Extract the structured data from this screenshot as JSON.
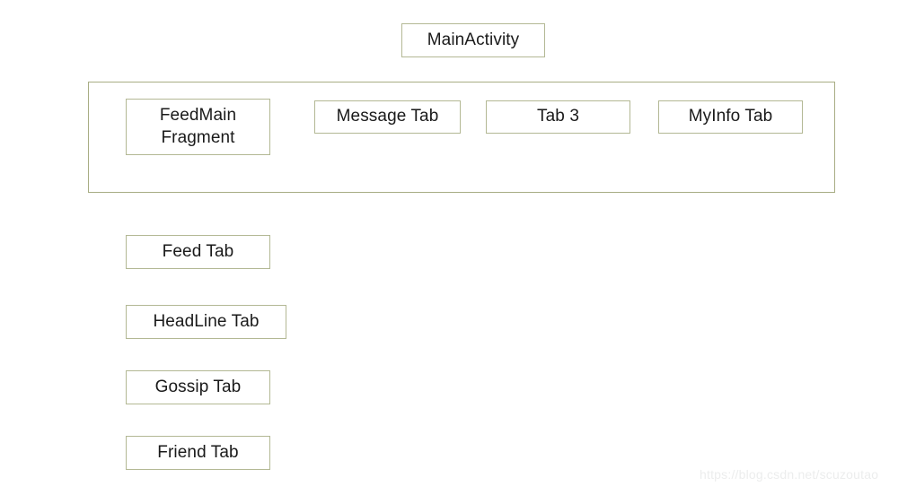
{
  "diagram": {
    "title_node": {
      "label": "MainActivity"
    },
    "container": {
      "name": "main-activity-tab-container",
      "border_color": "#a8ad84"
    },
    "tab_row": [
      {
        "id": "feedmain-fragment",
        "label": "FeedMain\nFragment"
      },
      {
        "id": "message-tab",
        "label": "Message Tab"
      },
      {
        "id": "tab-3",
        "label": "Tab 3"
      },
      {
        "id": "myinfo-tab",
        "label": "MyInfo Tab"
      }
    ],
    "fragment_tabs": [
      {
        "id": "feed-tab",
        "label": "Feed Tab"
      },
      {
        "id": "headline-tab",
        "label": "HeadLine Tab"
      },
      {
        "id": "gossip-tab",
        "label": "Gossip Tab"
      },
      {
        "id": "friend-tab",
        "label": "Friend Tab"
      }
    ],
    "node_border_color": "#b3b894",
    "text_color": "#1a1a1a",
    "background_color": "#ffffff"
  },
  "watermark": {
    "text": "https://blog.csdn.net/scuzoutao",
    "color": "#eceded"
  }
}
